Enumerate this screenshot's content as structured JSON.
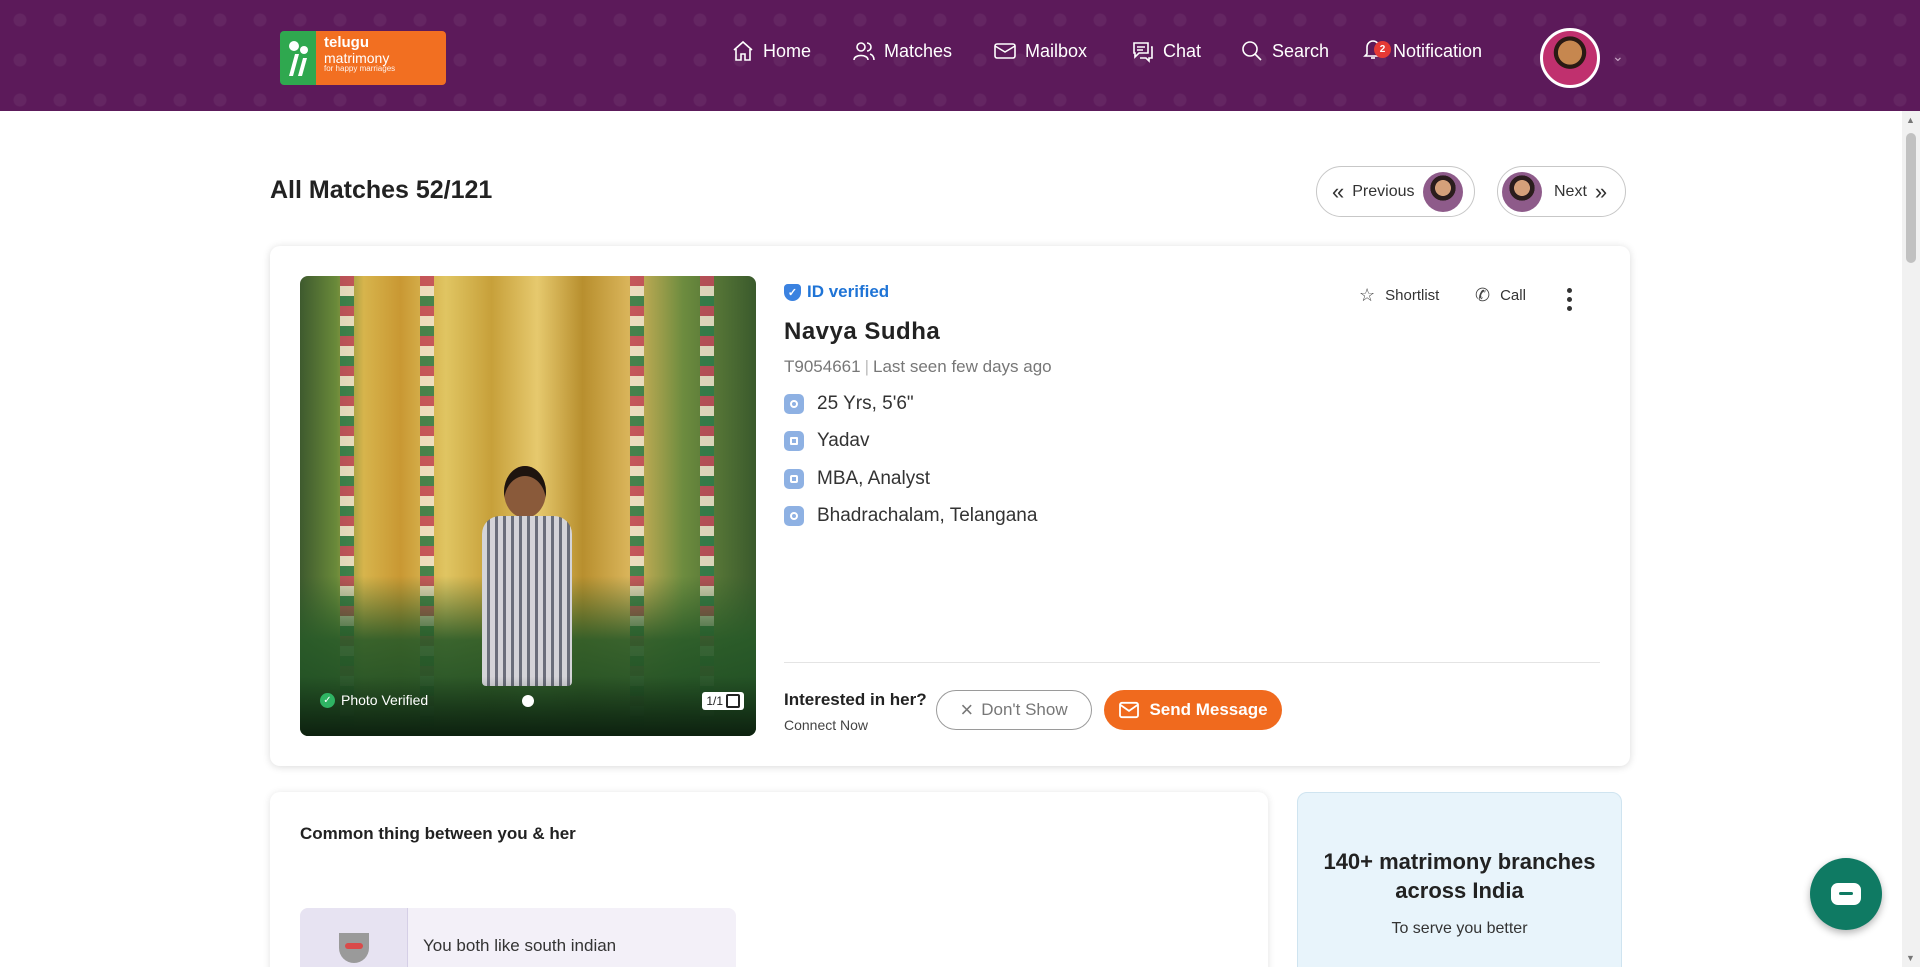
{
  "brand": {
    "logo_line1": "telugu",
    "logo_line2": "matrimony",
    "logo_tagline": "for happy marriages",
    "color_header": "#5c1a5a",
    "color_accent": "#f06a1e"
  },
  "nav": {
    "home": "Home",
    "matches": "Matches",
    "mailbox": "Mailbox",
    "chat": "Chat",
    "search": "Search",
    "notification": "Notification",
    "notification_count": "2"
  },
  "page": {
    "title": "All Matches 52/121",
    "previous_label": "Previous",
    "next_label": "Next"
  },
  "profile": {
    "id_verified": "ID verified",
    "name": "Navya Sudha",
    "member_id": "T9054661",
    "last_seen": "Last seen few days ago",
    "age_height": "25 Yrs, 5'6\"",
    "community": "Yadav",
    "education_job": "MBA, Analyst",
    "location": "Bhadrachalam, Telangana",
    "photo_verified": "Photo Verified",
    "photo_count": "1/1",
    "shortlist_label": "Shortlist",
    "call_label": "Call"
  },
  "interest": {
    "question": "Interested in her?",
    "sub": "Connect Now",
    "dont_show": "Don't Show",
    "send_message": "Send Message"
  },
  "common": {
    "title": "Common thing between you & her",
    "item": "You both like south indian"
  },
  "branches": {
    "title": "140+ matrimony branches across India",
    "sub": "To serve you better"
  }
}
